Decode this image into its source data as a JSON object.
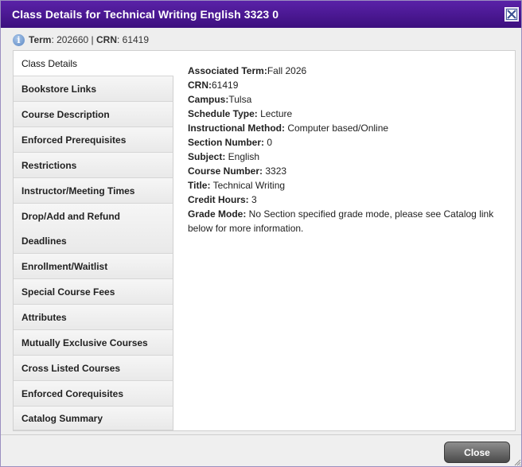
{
  "dialog": {
    "title": "Class Details for Technical Writing English 3323 0",
    "close_button": "Close"
  },
  "info": {
    "term_label": "Term",
    "term_value": "202660",
    "separator": "|",
    "crn_label": "CRN",
    "crn_value": "61419"
  },
  "nav": [
    {
      "label": "Class Details",
      "active": true
    },
    {
      "label": "Bookstore Links"
    },
    {
      "label": "Course Description"
    },
    {
      "label": "Enforced Prerequisites"
    },
    {
      "label": "Restrictions"
    },
    {
      "label": "Instructor/Meeting Times"
    },
    {
      "label": "Drop/Add and Refund Deadlines"
    },
    {
      "label": "Enrollment/Waitlist"
    },
    {
      "label": "Special Course Fees"
    },
    {
      "label": "Attributes"
    },
    {
      "label": "Mutually Exclusive Courses"
    },
    {
      "label": "Cross Listed Courses"
    },
    {
      "label": "Enforced Corequisites"
    },
    {
      "label": "Catalog Summary"
    }
  ],
  "details": [
    {
      "label": "Associated Term:",
      "value": "Fall 2026"
    },
    {
      "label": "CRN:",
      "value": "61419"
    },
    {
      "label": "Campus:",
      "value": "Tulsa"
    },
    {
      "label": "Schedule Type:",
      "value": " Lecture"
    },
    {
      "label": "Instructional Method:",
      "value": " Computer based/Online"
    },
    {
      "label": "Section Number:",
      "value": " 0"
    },
    {
      "label": "Subject:",
      "value": " English"
    },
    {
      "label": "Course Number:",
      "value": " 3323"
    },
    {
      "label": "Title:",
      "value": " Technical Writing"
    },
    {
      "label": "Credit Hours:",
      "value": " 3"
    },
    {
      "label": "Grade Mode:",
      "value": " No Section specified grade mode, please see Catalog link below for more information."
    }
  ]
}
